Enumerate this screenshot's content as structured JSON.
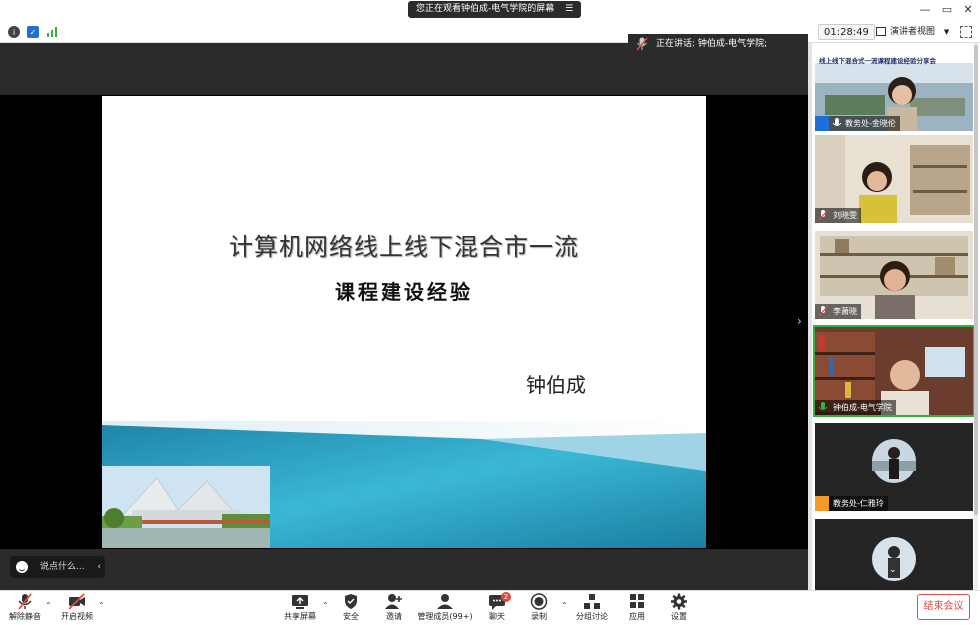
{
  "window": {
    "share_banner": "您正在观看钟伯成-电气学院的屏幕",
    "controls": [
      "—",
      "▭",
      "✕"
    ]
  },
  "topbar": {
    "timer": "01:28:49",
    "view_label": "演讲者视图"
  },
  "speaking": "正在讲话: 钟伯成-电气学院;",
  "slide": {
    "title": "计算机网络线上线下混合市一流",
    "subtitle": "课程建设经验",
    "author": "钟伯成"
  },
  "chat_placeholder": "说点什么...",
  "participants": [
    {
      "name": "教务处-金晓伦",
      "banner": "线上线下混合式一流课程建设经验分享会",
      "muted": false,
      "avatar_icon": "person-icon"
    },
    {
      "name": "刘晓雯",
      "muted": true
    },
    {
      "name": "李萧晓",
      "muted": true
    },
    {
      "name": "钟伯成-电气学院",
      "muted": false,
      "active": true
    },
    {
      "name": "教务处-仁雅玲",
      "muted": true,
      "avatar_icon": "person-icon"
    },
    {
      "name": "",
      "muted": true
    }
  ],
  "toolbar": {
    "unmute": "解除静音",
    "start_video": "开启视频",
    "share": "共享屏幕",
    "security": "安全",
    "invite": "邀请",
    "participants": "管理成员(99+)",
    "chat": "聊天",
    "chat_badge": "2",
    "record": "录制",
    "breakout": "分组讨论",
    "apps": "应用",
    "settings": "设置",
    "end": "结束会议"
  },
  "colors": {
    "accent_green": "#2fb33f",
    "end_red": "#e24b43",
    "slide_teal": "#2a9fc0"
  }
}
